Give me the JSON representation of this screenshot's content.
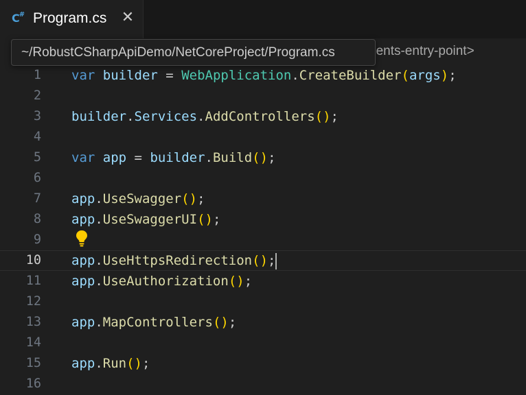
{
  "tab": {
    "icon": "csharp-file-icon",
    "icon_text": "C",
    "icon_sup": "#",
    "label": "Program.cs",
    "close_glyph": "✕"
  },
  "breadcrumb": {
    "visible_tail": "nents-entry-point>"
  },
  "tooltip": {
    "path": "~/RobustCSharpApiDemo/NetCoreProject/Program.cs"
  },
  "editor": {
    "current_line": 10,
    "lines": [
      {
        "n": "1",
        "tokens": [
          [
            "kw",
            "var"
          ],
          [
            "pn",
            " "
          ],
          [
            "var",
            "builder"
          ],
          [
            "pn",
            " = "
          ],
          [
            "type",
            "WebApplication"
          ],
          [
            "pn",
            "."
          ],
          [
            "fn",
            "CreateBuilder"
          ],
          [
            "br",
            "("
          ],
          [
            "var",
            "args"
          ],
          [
            "br",
            ")"
          ],
          [
            "pn",
            ";"
          ]
        ]
      },
      {
        "n": "2",
        "tokens": []
      },
      {
        "n": "3",
        "tokens": [
          [
            "var",
            "builder"
          ],
          [
            "pn",
            "."
          ],
          [
            "var",
            "Services"
          ],
          [
            "pn",
            "."
          ],
          [
            "fn",
            "AddControllers"
          ],
          [
            "br",
            "()"
          ],
          [
            "pn",
            ";"
          ]
        ]
      },
      {
        "n": "4",
        "tokens": []
      },
      {
        "n": "5",
        "tokens": [
          [
            "kw",
            "var"
          ],
          [
            "pn",
            " "
          ],
          [
            "var",
            "app"
          ],
          [
            "pn",
            " = "
          ],
          [
            "var",
            "builder"
          ],
          [
            "pn",
            "."
          ],
          [
            "fn",
            "Build"
          ],
          [
            "br",
            "()"
          ],
          [
            "pn",
            ";"
          ]
        ]
      },
      {
        "n": "6",
        "tokens": []
      },
      {
        "n": "7",
        "tokens": [
          [
            "var",
            "app"
          ],
          [
            "pn",
            "."
          ],
          [
            "fn",
            "UseSwagger"
          ],
          [
            "br",
            "()"
          ],
          [
            "pn",
            ";"
          ]
        ]
      },
      {
        "n": "8",
        "tokens": [
          [
            "var",
            "app"
          ],
          [
            "pn",
            "."
          ],
          [
            "fn",
            "UseSwaggerUI"
          ],
          [
            "br",
            "()"
          ],
          [
            "pn",
            ";"
          ]
        ]
      },
      {
        "n": "9",
        "tokens": []
      },
      {
        "n": "10",
        "tokens": [
          [
            "var",
            "app"
          ],
          [
            "pn",
            "."
          ],
          [
            "fn",
            "UseHttpsRedirection"
          ],
          [
            "br",
            "()"
          ],
          [
            "pn",
            ";"
          ]
        ]
      },
      {
        "n": "11",
        "tokens": [
          [
            "var",
            "app"
          ],
          [
            "pn",
            "."
          ],
          [
            "fn",
            "UseAuthorization"
          ],
          [
            "br",
            "()"
          ],
          [
            "pn",
            ";"
          ]
        ]
      },
      {
        "n": "12",
        "tokens": []
      },
      {
        "n": "13",
        "tokens": [
          [
            "var",
            "app"
          ],
          [
            "pn",
            "."
          ],
          [
            "fn",
            "MapControllers"
          ],
          [
            "br",
            "()"
          ],
          [
            "pn",
            ";"
          ]
        ]
      },
      {
        "n": "14",
        "tokens": []
      },
      {
        "n": "15",
        "tokens": [
          [
            "var",
            "app"
          ],
          [
            "pn",
            "."
          ],
          [
            "fn",
            "Run"
          ],
          [
            "br",
            "()"
          ],
          [
            "pn",
            ";"
          ]
        ]
      },
      {
        "n": "16",
        "tokens": []
      }
    ],
    "lightbulb_icon": "lightbulb-icon"
  },
  "colors": {
    "keyword": "#569cd6",
    "variable": "#9cdcfe",
    "type": "#4ec9b0",
    "function": "#dcdcaa",
    "bracket": "#ffd700",
    "lightbulb": "#ffcc00"
  }
}
